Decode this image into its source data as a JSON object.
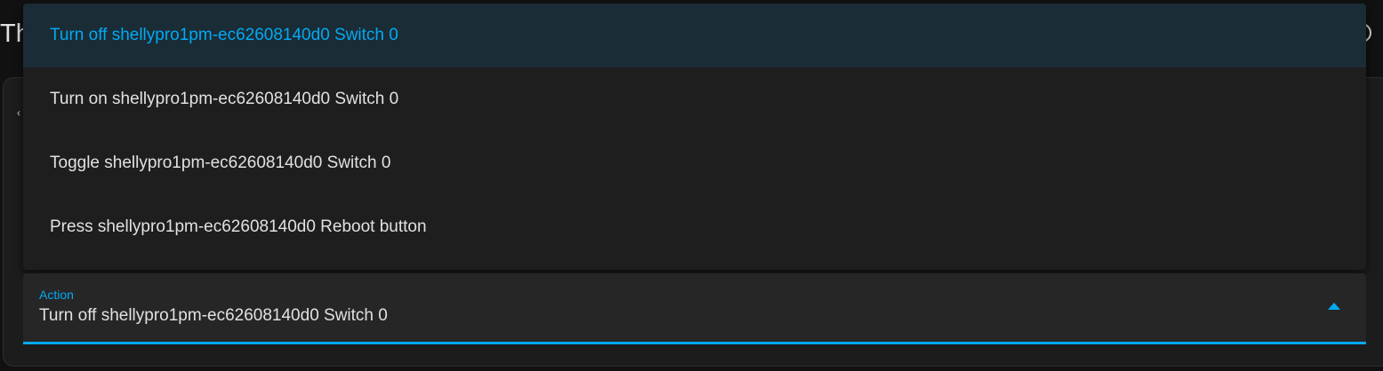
{
  "page": {
    "heading_fragment": "Th"
  },
  "menu": {
    "items": [
      {
        "label": "Turn off shellypro1pm-ec62608140d0 Switch 0",
        "selected": true
      },
      {
        "label": "Turn on shellypro1pm-ec62608140d0 Switch 0",
        "selected": false
      },
      {
        "label": "Toggle shellypro1pm-ec62608140d0 Switch 0",
        "selected": false
      },
      {
        "label": "Press shellypro1pm-ec62608140d0 Reboot button",
        "selected": false
      }
    ]
  },
  "action_select": {
    "label": "Action",
    "value": "Turn off shellypro1pm-ec62608140d0 Switch 0",
    "expanded": true
  },
  "colors": {
    "accent": "#03a9f4",
    "background": "#111111",
    "menu_background": "#1e1e1e",
    "selected_item_background": "#1a2c35",
    "text": "#e1e1e1"
  },
  "icons": {
    "dropdown_caret": "caret-up-icon",
    "heading_right": "circle-icon"
  }
}
